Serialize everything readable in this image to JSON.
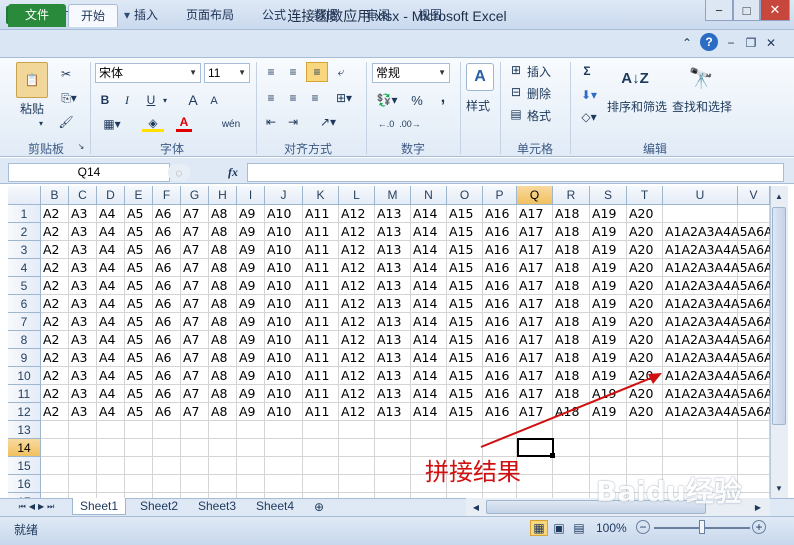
{
  "window": {
    "title": "连接函数应用.xlsx - Microsoft Excel",
    "app_icon": "excel-icon",
    "minimize": "−",
    "maximize": "□",
    "close": "✕"
  },
  "tabs": [
    "文件",
    "开始",
    "插入",
    "页面布局",
    "公式",
    "数据",
    "审阅",
    "视图"
  ],
  "ribbon": {
    "clipboard": {
      "label": "剪贴板",
      "paste": "粘贴"
    },
    "font": {
      "label": "字体",
      "name": "宋体",
      "size": "11",
      "bold": "B",
      "italic": "I",
      "underline": "U",
      "grow": "A",
      "shrink": "A",
      "font_color": "A",
      "phonetic": "wén"
    },
    "alignment": {
      "label": "对齐方式"
    },
    "number": {
      "label": "数字",
      "format": "常规",
      "percent": "%",
      "comma": ","
    },
    "styles": {
      "label": "样式"
    },
    "cells": {
      "label": "单元格",
      "insert": "插入",
      "delete": "删除",
      "format": "格式"
    },
    "editing": {
      "label": "编辑",
      "sort_filter": "排序和筛选",
      "find_select": "查找和选择",
      "sigma": "Σ"
    }
  },
  "formula_bar": {
    "name_box": "Q14",
    "fx": "fx",
    "formula": ""
  },
  "grid": {
    "columns": [
      "B",
      "C",
      "D",
      "E",
      "F",
      "G",
      "H",
      "I",
      "J",
      "K",
      "L",
      "M",
      "N",
      "O",
      "P",
      "Q",
      "R",
      "S",
      "T",
      "U",
      "V"
    ],
    "selected_column": "Q",
    "selected_row": "14",
    "rows": [
      "1",
      "2",
      "3",
      "4",
      "5",
      "6",
      "7",
      "8",
      "9",
      "10",
      "11",
      "12",
      "13",
      "14",
      "15",
      "16",
      "17"
    ],
    "data_row_cells": [
      "A2",
      "A3",
      "A4",
      "A5",
      "A6",
      "A7",
      "A8",
      "A9",
      "A10",
      "A11",
      "A12",
      "A13",
      "A14",
      "A15",
      "A16",
      "A17",
      "A18",
      "A19",
      "A20"
    ],
    "result_text": "A1A2A3A4A5A6A7",
    "data_row_count": 12,
    "result_rows_from": 2
  },
  "sheets": [
    "Sheet1",
    "Sheet2",
    "Sheet3",
    "Sheet4"
  ],
  "active_sheet": "Sheet1",
  "status": {
    "ready": "就绪",
    "zoom": "100%"
  },
  "annotation": {
    "text": "拼接结果",
    "color": "#d01010"
  },
  "watermark": "Baidu经验"
}
